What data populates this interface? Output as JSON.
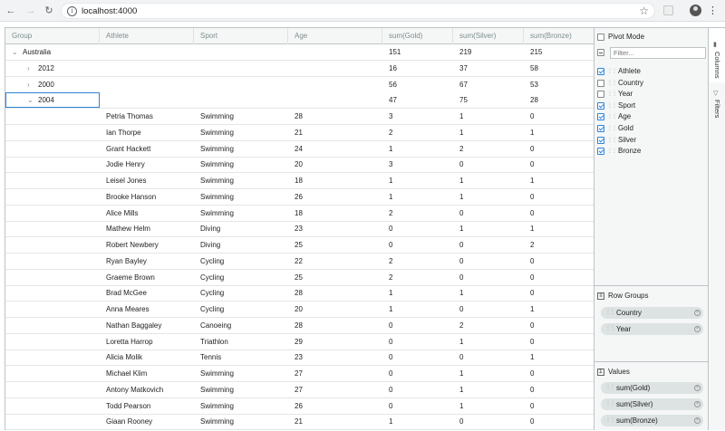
{
  "browser": {
    "url": "localhost:4000"
  },
  "grid": {
    "headers": [
      "Group",
      "Athlete",
      "Sport",
      "Age",
      "sum(Gold)",
      "sum(Silver)",
      "sum(Bronze)"
    ],
    "group_rows": [
      {
        "label": "Australia",
        "expanded": true,
        "gold": "151",
        "silver": "219",
        "bronze": "215"
      },
      {
        "label": "2012",
        "expanded": false,
        "gold": "16",
        "silver": "37",
        "bronze": "58"
      },
      {
        "label": "2000",
        "expanded": false,
        "gold": "56",
        "silver": "67",
        "bronze": "53"
      },
      {
        "label": "2004",
        "expanded": true,
        "gold": "47",
        "silver": "75",
        "bronze": "28"
      }
    ],
    "rows": [
      {
        "athlete": "Petria Thomas",
        "sport": "Swimming",
        "age": "28",
        "gold": "3",
        "silver": "1",
        "bronze": "0"
      },
      {
        "athlete": "Ian Thorpe",
        "sport": "Swimming",
        "age": "21",
        "gold": "2",
        "silver": "1",
        "bronze": "1"
      },
      {
        "athlete": "Grant Hackett",
        "sport": "Swimming",
        "age": "24",
        "gold": "1",
        "silver": "2",
        "bronze": "0"
      },
      {
        "athlete": "Jodie Henry",
        "sport": "Swimming",
        "age": "20",
        "gold": "3",
        "silver": "0",
        "bronze": "0"
      },
      {
        "athlete": "Leisel Jones",
        "sport": "Swimming",
        "age": "18",
        "gold": "1",
        "silver": "1",
        "bronze": "1"
      },
      {
        "athlete": "Brooke Hanson",
        "sport": "Swimming",
        "age": "26",
        "gold": "1",
        "silver": "1",
        "bronze": "0"
      },
      {
        "athlete": "Alice Mills",
        "sport": "Swimming",
        "age": "18",
        "gold": "2",
        "silver": "0",
        "bronze": "0"
      },
      {
        "athlete": "Mathew Helm",
        "sport": "Diving",
        "age": "23",
        "gold": "0",
        "silver": "1",
        "bronze": "1"
      },
      {
        "athlete": "Robert Newbery",
        "sport": "Diving",
        "age": "25",
        "gold": "0",
        "silver": "0",
        "bronze": "2"
      },
      {
        "athlete": "Ryan Bayley",
        "sport": "Cycling",
        "age": "22",
        "gold": "2",
        "silver": "0",
        "bronze": "0"
      },
      {
        "athlete": "Graeme Brown",
        "sport": "Cycling",
        "age": "25",
        "gold": "2",
        "silver": "0",
        "bronze": "0"
      },
      {
        "athlete": "Brad McGee",
        "sport": "Cycling",
        "age": "28",
        "gold": "1",
        "silver": "1",
        "bronze": "0"
      },
      {
        "athlete": "Anna Meares",
        "sport": "Cycling",
        "age": "20",
        "gold": "1",
        "silver": "0",
        "bronze": "1"
      },
      {
        "athlete": "Nathan Baggaley",
        "sport": "Canoeing",
        "age": "28",
        "gold": "0",
        "silver": "2",
        "bronze": "0"
      },
      {
        "athlete": "Loretta Harrop",
        "sport": "Triathlon",
        "age": "29",
        "gold": "0",
        "silver": "1",
        "bronze": "0"
      },
      {
        "athlete": "Alicia Molik",
        "sport": "Tennis",
        "age": "23",
        "gold": "0",
        "silver": "0",
        "bronze": "1"
      },
      {
        "athlete": "Michael Klim",
        "sport": "Swimming",
        "age": "27",
        "gold": "0",
        "silver": "1",
        "bronze": "0"
      },
      {
        "athlete": "Antony Matkovich",
        "sport": "Swimming",
        "age": "27",
        "gold": "0",
        "silver": "1",
        "bronze": "0"
      },
      {
        "athlete": "Todd Pearson",
        "sport": "Swimming",
        "age": "26",
        "gold": "0",
        "silver": "1",
        "bronze": "0"
      },
      {
        "athlete": "Giaan Rooney",
        "sport": "Swimming",
        "age": "21",
        "gold": "1",
        "silver": "0",
        "bronze": "0"
      }
    ]
  },
  "panel": {
    "pivot_mode_label": "Pivot Mode",
    "filter_placeholder": "Filter...",
    "columns": [
      {
        "label": "Athlete",
        "checked": true
      },
      {
        "label": "Country",
        "checked": false
      },
      {
        "label": "Year",
        "checked": false
      },
      {
        "label": "Sport",
        "checked": true
      },
      {
        "label": "Age",
        "checked": true
      },
      {
        "label": "Gold",
        "checked": true
      },
      {
        "label": "Silver",
        "checked": true
      },
      {
        "label": "Bronze",
        "checked": true
      }
    ],
    "row_groups_title": "Row Groups",
    "row_groups": [
      "Country",
      "Year"
    ],
    "values_title": "Values",
    "values": [
      "sum(Gold)",
      "sum(Silver)",
      "sum(Bronze)"
    ],
    "tabs": {
      "columns": "Columns",
      "filters": "Filters"
    }
  }
}
